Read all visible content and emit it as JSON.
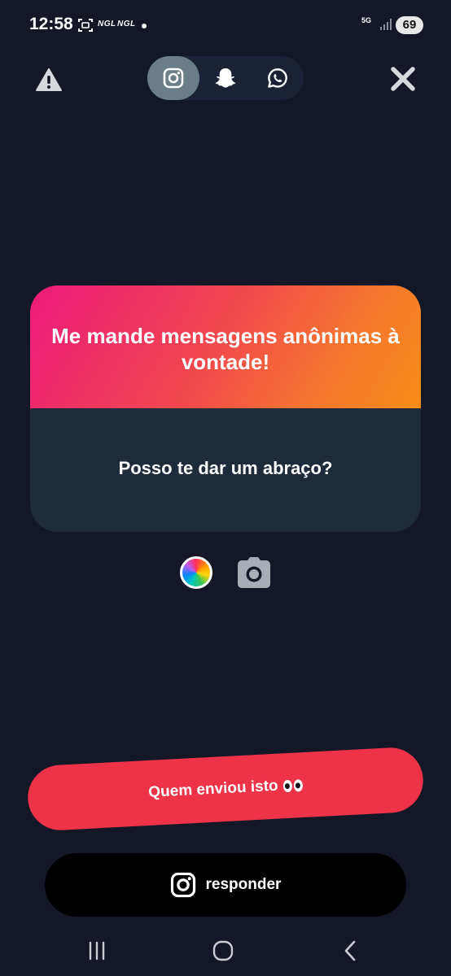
{
  "status_bar": {
    "time": "12:58",
    "notif_1": "NGL",
    "notif_2": "NGL",
    "network": "5G",
    "battery": "69"
  },
  "header": {
    "share_targets": [
      {
        "name": "instagram",
        "active": true
      },
      {
        "name": "snapchat",
        "active": false
      },
      {
        "name": "whatsapp",
        "active": false
      }
    ]
  },
  "card": {
    "prompt": "Me mande mensagens anônimas à vontade!",
    "message": "Posso te dar um abraço?",
    "gradient": [
      "#ec1a7c",
      "#f98d17"
    ]
  },
  "actions": {
    "who_sent": "Quem enviou isto",
    "reply": "responder"
  },
  "colors": {
    "background": "#141826",
    "card_bottom": "#1f2a3b",
    "who_button": "#ee3348",
    "reply_button": "#000000"
  },
  "icons": [
    "warning-icon",
    "instagram-icon",
    "snapchat-icon",
    "whatsapp-icon",
    "close-icon",
    "color-wheel-icon",
    "camera-icon",
    "recents-icon",
    "home-icon",
    "back-icon"
  ]
}
